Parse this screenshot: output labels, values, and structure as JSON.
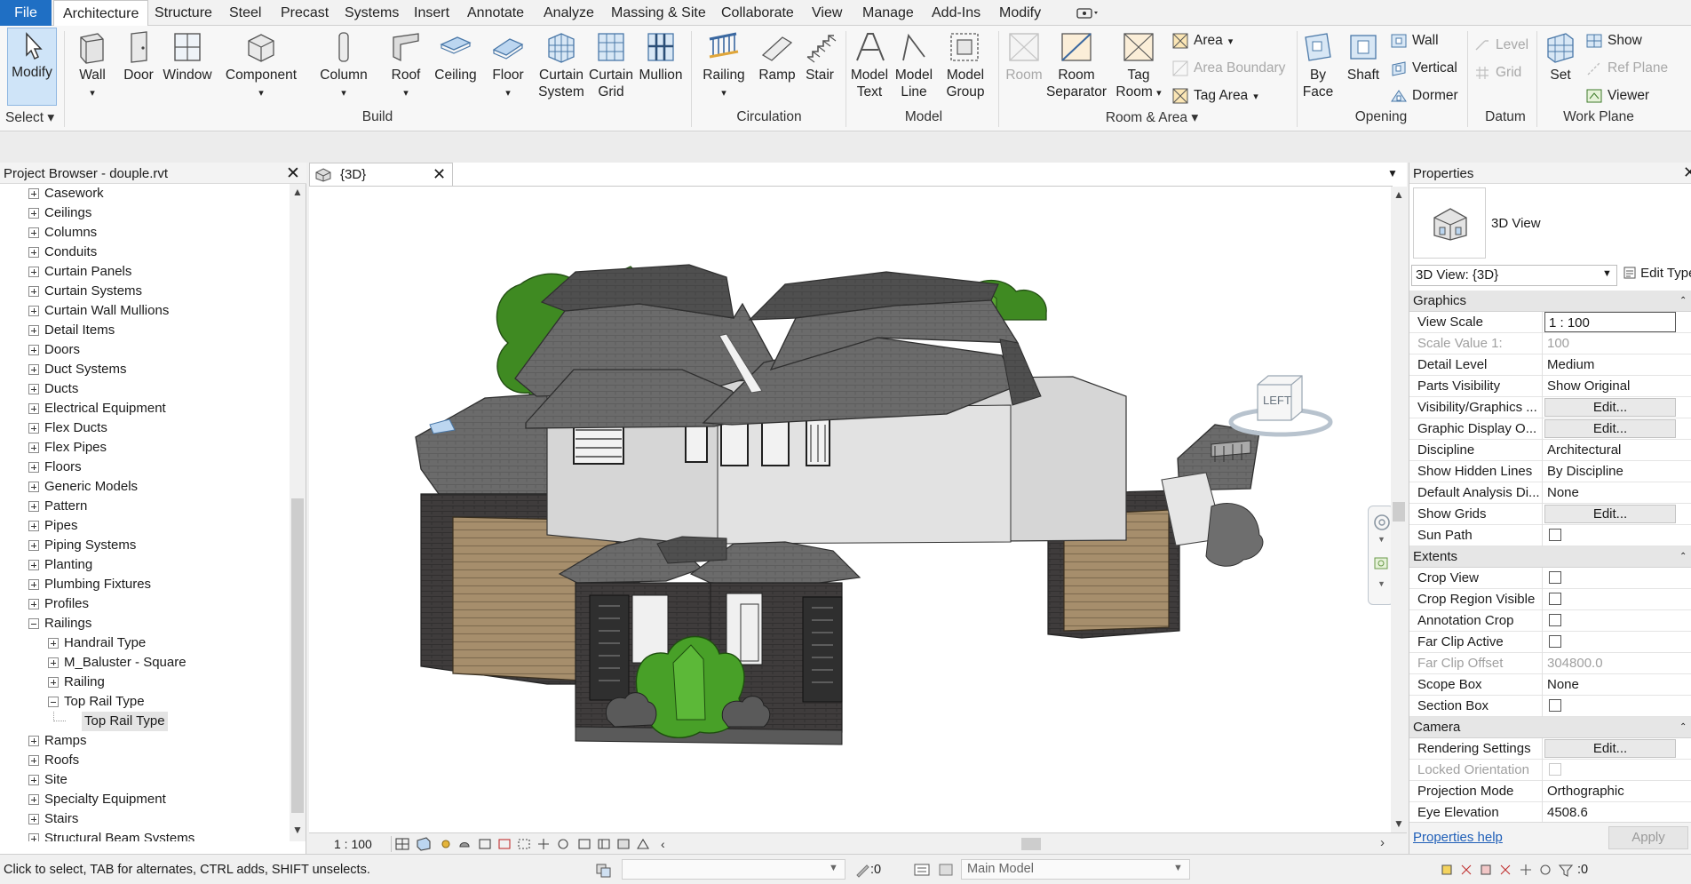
{
  "menubar": {
    "file": "File",
    "tabs": [
      "Architecture",
      "Structure",
      "Steel",
      "Precast",
      "Systems",
      "Insert",
      "Annotate",
      "Analyze",
      "Massing & Site",
      "Collaborate",
      "View",
      "Manage",
      "Add-Ins",
      "Modify"
    ],
    "active_tab": "Architecture"
  },
  "ribbon": {
    "select": {
      "modify": "Modify",
      "group": "Select"
    },
    "build": {
      "wall": "Wall",
      "door": "Door",
      "window": "Window",
      "component": "Component",
      "column": "Column",
      "roof": "Roof",
      "ceiling": "Ceiling",
      "floor": "Floor",
      "curtain_system_1": "Curtain",
      "curtain_system_2": "System",
      "curtain_grid_1": "Curtain",
      "curtain_grid_2": "Grid",
      "mullion": "Mullion",
      "group": "Build"
    },
    "circulation": {
      "railing": "Railing",
      "ramp": "Ramp",
      "stair": "Stair",
      "group": "Circulation"
    },
    "model": {
      "model_text_1": "Model",
      "model_text_2": "Text",
      "model_line_1": "Model",
      "model_line_2": "Line",
      "model_group_1": "Model",
      "model_group_2": "Group",
      "group": "Model"
    },
    "room_area": {
      "room": "Room",
      "room_sep_1": "Room",
      "room_sep_2": "Separator",
      "tag_room_1": "Tag",
      "tag_room_2": "Room",
      "area": "Area",
      "area_boundary": "Area  Boundary",
      "tag_area": "Tag  Area",
      "group": "Room & Area"
    },
    "opening": {
      "by_face_1": "By",
      "by_face_2": "Face",
      "shaft": "Shaft",
      "wall": "Wall",
      "vertical": "Vertical",
      "dormer": "Dormer",
      "group": "Opening"
    },
    "datum": {
      "level": "Level",
      "grid": "Grid",
      "group": "Datum"
    },
    "work_plane": {
      "set": "Set",
      "show": "Show",
      "ref_plane": "Ref  Plane",
      "viewer": "Viewer",
      "group": "Work Plane"
    }
  },
  "project_browser": {
    "title": "Project Browser - douple.rvt",
    "items": [
      {
        "label": "Casework",
        "level": 0,
        "state": "plus"
      },
      {
        "label": "Ceilings",
        "level": 0,
        "state": "plus"
      },
      {
        "label": "Columns",
        "level": 0,
        "state": "plus"
      },
      {
        "label": "Conduits",
        "level": 0,
        "state": "plus"
      },
      {
        "label": "Curtain Panels",
        "level": 0,
        "state": "plus"
      },
      {
        "label": "Curtain Systems",
        "level": 0,
        "state": "plus"
      },
      {
        "label": "Curtain Wall Mullions",
        "level": 0,
        "state": "plus"
      },
      {
        "label": "Detail Items",
        "level": 0,
        "state": "plus"
      },
      {
        "label": "Doors",
        "level": 0,
        "state": "plus"
      },
      {
        "label": "Duct Systems",
        "level": 0,
        "state": "plus"
      },
      {
        "label": "Ducts",
        "level": 0,
        "state": "plus"
      },
      {
        "label": "Electrical Equipment",
        "level": 0,
        "state": "plus"
      },
      {
        "label": "Flex Ducts",
        "level": 0,
        "state": "plus"
      },
      {
        "label": "Flex Pipes",
        "level": 0,
        "state": "plus"
      },
      {
        "label": "Floors",
        "level": 0,
        "state": "plus"
      },
      {
        "label": "Generic Models",
        "level": 0,
        "state": "plus"
      },
      {
        "label": "Pattern",
        "level": 0,
        "state": "plus"
      },
      {
        "label": "Pipes",
        "level": 0,
        "state": "plus"
      },
      {
        "label": "Piping Systems",
        "level": 0,
        "state": "plus"
      },
      {
        "label": "Planting",
        "level": 0,
        "state": "plus"
      },
      {
        "label": "Plumbing Fixtures",
        "level": 0,
        "state": "plus"
      },
      {
        "label": "Profiles",
        "level": 0,
        "state": "plus"
      },
      {
        "label": "Railings",
        "level": 0,
        "state": "minus"
      },
      {
        "label": "Handrail Type",
        "level": 1,
        "state": "plus"
      },
      {
        "label": "M_Baluster - Square",
        "level": 1,
        "state": "plus"
      },
      {
        "label": "Railing",
        "level": 1,
        "state": "plus"
      },
      {
        "label": "Top Rail Type",
        "level": 1,
        "state": "minus"
      },
      {
        "label": "Top Rail Type",
        "level": 2,
        "state": "leaf",
        "selected": true
      },
      {
        "label": "Ramps",
        "level": 0,
        "state": "plus"
      },
      {
        "label": "Roofs",
        "level": 0,
        "state": "plus"
      },
      {
        "label": "Site",
        "level": 0,
        "state": "plus"
      },
      {
        "label": "Specialty Equipment",
        "level": 0,
        "state": "plus"
      },
      {
        "label": "Stairs",
        "level": 0,
        "state": "plus"
      },
      {
        "label": "Structural Beam Systems",
        "level": 0,
        "state": "plus"
      }
    ]
  },
  "view": {
    "tab_title": "{3D}",
    "viewcube_label": "LEFT",
    "scale": "1 : 100"
  },
  "properties": {
    "title": "Properties",
    "type_name": "3D View",
    "selector": "3D View: {3D}",
    "edit_type": "Edit Type",
    "sections": {
      "graphics": "Graphics",
      "extents": "Extents",
      "camera": "Camera"
    },
    "graphics_rows": [
      {
        "key": "View Scale",
        "value": "1 : 100",
        "kind": "input"
      },
      {
        "key": "Scale Value    1:",
        "value": "100",
        "kind": "text",
        "disabled": true
      },
      {
        "key": "Detail Level",
        "value": "Medium",
        "kind": "text"
      },
      {
        "key": "Parts Visibility",
        "value": "Show Original",
        "kind": "text"
      },
      {
        "key": "Visibility/Graphics ...",
        "value": "Edit...",
        "kind": "button"
      },
      {
        "key": "Graphic Display O...",
        "value": "Edit...",
        "kind": "button"
      },
      {
        "key": "Discipline",
        "value": "Architectural",
        "kind": "text"
      },
      {
        "key": "Show Hidden Lines",
        "value": "By Discipline",
        "kind": "text"
      },
      {
        "key": "Default Analysis Di...",
        "value": "None",
        "kind": "text"
      },
      {
        "key": "Show Grids",
        "value": "Edit...",
        "kind": "button"
      },
      {
        "key": "Sun Path",
        "value": "",
        "kind": "check"
      }
    ],
    "extents_rows": [
      {
        "key": "Crop View",
        "value": "",
        "kind": "check"
      },
      {
        "key": "Crop Region Visible",
        "value": "",
        "kind": "check"
      },
      {
        "key": "Annotation Crop",
        "value": "",
        "kind": "check"
      },
      {
        "key": "Far Clip Active",
        "value": "",
        "kind": "check"
      },
      {
        "key": "Far Clip Offset",
        "value": "304800.0",
        "kind": "text",
        "disabled": true
      },
      {
        "key": "Scope Box",
        "value": "None",
        "kind": "text"
      },
      {
        "key": "Section Box",
        "value": "",
        "kind": "check"
      }
    ],
    "camera_rows": [
      {
        "key": "Rendering Settings",
        "value": "Edit...",
        "kind": "button"
      },
      {
        "key": "Locked Orientation",
        "value": "",
        "kind": "check",
        "disabled": true
      },
      {
        "key": "Projection Mode",
        "value": "Orthographic",
        "kind": "text"
      },
      {
        "key": "Eye Elevation",
        "value": "4508.6",
        "kind": "text"
      }
    ],
    "help_link": "Properties help",
    "apply": "Apply"
  },
  "statusbar": {
    "message": "Click to select, TAB for alternates, CTRL adds, SHIFT unselects.",
    "workset_count": ":0",
    "model": "Main Model",
    "filter_count": ":0"
  },
  "colors": {
    "file_blue": "#1f6fc4",
    "link_blue": "#1f5fb8",
    "tree_green": "#3a8a1e",
    "roof_grey": "#6f6f6f",
    "brick": "#3d3a3a",
    "cladding": "#a58d6b"
  }
}
